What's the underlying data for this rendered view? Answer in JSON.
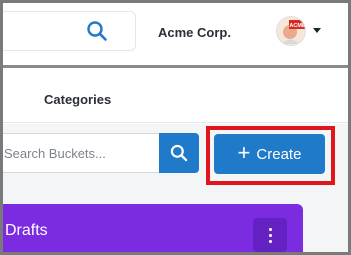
{
  "header": {
    "company_name": "Acme Corp.",
    "avatar_badge": "ACME",
    "search_icon": "search-icon",
    "caret_icon": "caret-down-icon"
  },
  "nav": {
    "categories_label": "Categories"
  },
  "toolbar": {
    "bucket_search_placeholder": "Search Buckets...",
    "bucket_search_value": "",
    "create_label": "Create",
    "create_icon": "plus-icon"
  },
  "bucket": {
    "title": "Drafts",
    "menu_icon": "kebab-menu-icon"
  },
  "colors": {
    "primary": "#1f7ac9",
    "highlight": "#e0161c",
    "bucket_card": "#7b2be0"
  }
}
